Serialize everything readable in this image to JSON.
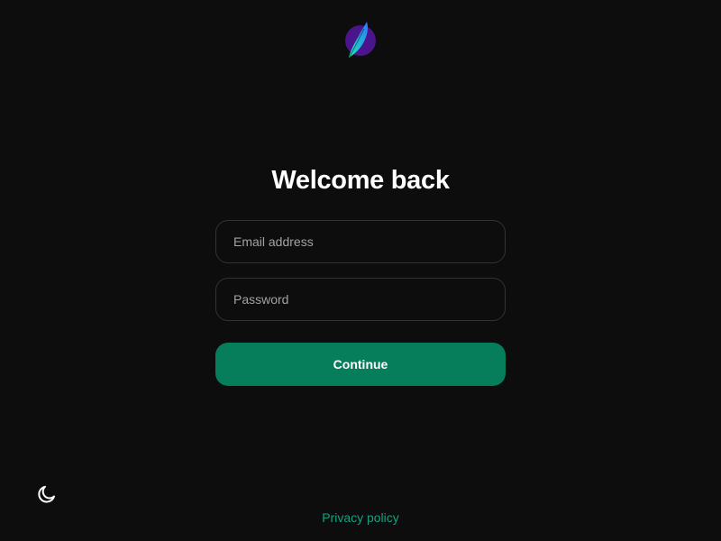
{
  "brand": {
    "logo_icon": "feather-logo-icon",
    "colors": {
      "background": "#0d0d0d",
      "accent": "#067d5b",
      "link": "#10a37f",
      "logo_circle": "#4a148c",
      "logo_feather_start": "#1de9b6",
      "logo_feather_end": "#2979ff"
    }
  },
  "login": {
    "title": "Welcome back",
    "email_placeholder": "Email address",
    "email_value": "",
    "password_placeholder": "Password",
    "password_value": "",
    "continue_label": "Continue"
  },
  "footer": {
    "theme_toggle_icon": "moon-icon",
    "privacy_label": "Privacy policy"
  }
}
